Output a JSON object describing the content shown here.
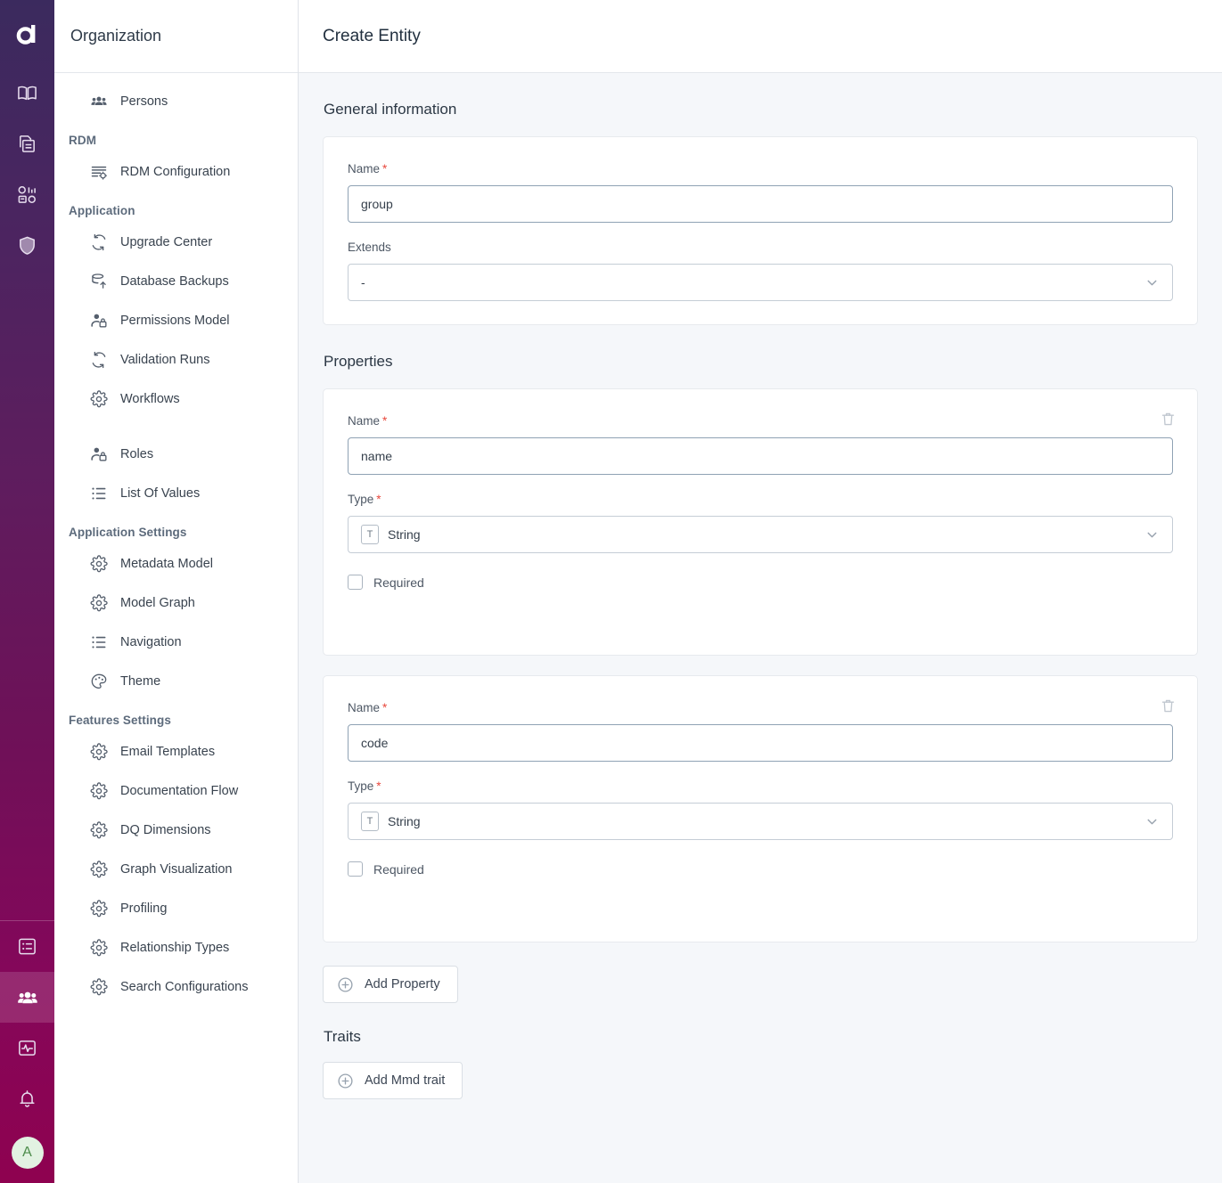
{
  "rail": {
    "logo": "a-logo",
    "top_items": [
      {
        "name": "book-icon",
        "label": "Glossary"
      },
      {
        "name": "catalog-icon",
        "label": "Catalog"
      },
      {
        "name": "data-quality-icon",
        "label": "Data Quality"
      },
      {
        "name": "shield-icon",
        "label": "Governance"
      }
    ],
    "bottom_items": [
      {
        "name": "list-icon",
        "label": "Tasks",
        "active": false
      },
      {
        "name": "people-icon",
        "label": "Organization",
        "active": true
      },
      {
        "name": "monitoring-icon",
        "label": "Monitoring",
        "active": false
      },
      {
        "name": "bell-icon",
        "label": "Notifications",
        "active": false
      }
    ],
    "avatar_initial": "A"
  },
  "sidebar": {
    "title": "Organization",
    "groups": [
      {
        "label": "",
        "items": [
          {
            "label": "Persons",
            "icon": "persons-icon"
          }
        ]
      },
      {
        "label": "RDM",
        "items": [
          {
            "label": "RDM Configuration",
            "icon": "rdm-config-icon"
          }
        ]
      },
      {
        "label": "Application",
        "items": [
          {
            "label": "Upgrade Center",
            "icon": "refresh-icon"
          },
          {
            "label": "Database Backups",
            "icon": "database-backup-icon"
          },
          {
            "label": "Permissions Model",
            "icon": "person-lock-icon"
          },
          {
            "label": "Validation Runs",
            "icon": "refresh-icon"
          },
          {
            "label": "Workflows",
            "icon": "gear-icon"
          },
          {
            "label": "Roles",
            "icon": "person-lock-icon",
            "spaced": true
          },
          {
            "label": "List Of Values",
            "icon": "list-icon"
          }
        ]
      },
      {
        "label": "Application Settings",
        "items": [
          {
            "label": "Metadata Model",
            "icon": "gear-icon"
          },
          {
            "label": "Model Graph",
            "icon": "gear-icon"
          },
          {
            "label": "Navigation",
            "icon": "list-icon"
          },
          {
            "label": "Theme",
            "icon": "palette-icon"
          }
        ]
      },
      {
        "label": "Features Settings",
        "items": [
          {
            "label": "Email Templates",
            "icon": "gear-icon"
          },
          {
            "label": "Documentation Flow",
            "icon": "gear-icon"
          },
          {
            "label": "DQ Dimensions",
            "icon": "gear-icon"
          },
          {
            "label": "Graph Visualization",
            "icon": "gear-icon"
          },
          {
            "label": "Profiling",
            "icon": "gear-icon"
          },
          {
            "label": "Relationship Types",
            "icon": "gear-icon"
          },
          {
            "label": "Search Configurations",
            "icon": "gear-icon"
          }
        ]
      }
    ]
  },
  "main": {
    "page_title": "Create Entity",
    "general": {
      "section_title": "General information",
      "name_label": "Name",
      "name_value": "group",
      "name_required": true,
      "extends_label": "Extends",
      "extends_value": "-"
    },
    "properties": {
      "section_title": "Properties",
      "items": [
        {
          "name_label": "Name",
          "name_value": "name",
          "type_label": "Type",
          "type_value": "String",
          "type_icon": "string-type-icon",
          "required_label": "Required",
          "required_checked": false
        },
        {
          "name_label": "Name",
          "name_value": "code",
          "type_label": "Type",
          "type_value": "String",
          "type_icon": "string-type-icon",
          "required_label": "Required",
          "required_checked": false
        }
      ],
      "add_button": "Add Property"
    },
    "traits": {
      "section_title": "Traits",
      "add_button": "Add Mmd trait"
    }
  },
  "colors": {
    "rail_top": "#3b2a5e",
    "rail_bottom": "#8e0250",
    "required_star": "#e8483d",
    "main_bg": "#f5f7fa",
    "avatar_bg": "#e2f2e2",
    "avatar_fg": "#4c8c4a"
  }
}
